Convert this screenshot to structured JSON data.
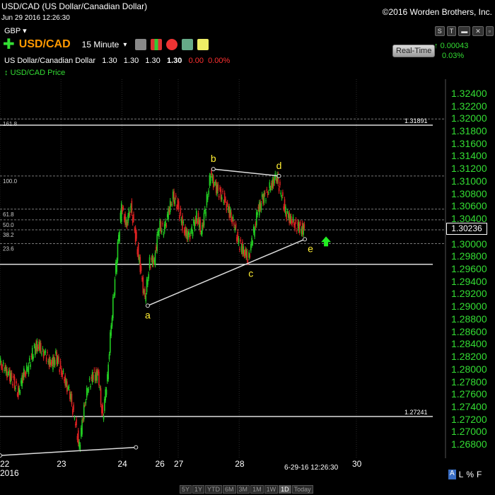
{
  "header": {
    "title": "USD/CAD (US Dollar/Canadian Dollar)",
    "date": "Jun 29 2016 12:26:30",
    "copyright": "©2016 Worden Brothers, Inc.",
    "currency": "GBP",
    "symbol": "USD/CAD",
    "interval": "15 Minute",
    "realtime_label": "Real-Time",
    "change": "0.00043",
    "change_pct": "0.03%",
    "window_buttons": [
      "S",
      "T",
      "▬",
      "✕",
      "▫"
    ]
  },
  "quote": {
    "name": "US Dollar/Canadian Dollar",
    "open": "1.30",
    "high": "1.30",
    "low": "1.30",
    "last": "1.30",
    "chg": "0.00",
    "chg_pct": "0.00%"
  },
  "legend": {
    "label": "USD/CAD Price"
  },
  "price_tag": "1.30236",
  "stamp": "6-29-16 12:26:30",
  "year_label": "2016",
  "period_buttons": [
    "5Y",
    "1Y",
    "YTD",
    "6M",
    "3M",
    "1M",
    "1W",
    "1D",
    "Today"
  ],
  "period_active": "1D",
  "corner_buttons": [
    "A",
    "L",
    "%",
    "F"
  ],
  "chart_data": {
    "type": "line",
    "style": "candlestick",
    "ylim": [
      1.266,
      1.326
    ],
    "y_ticks": [
      "1.32400",
      "1.32200",
      "1.32000",
      "1.31800",
      "1.31600",
      "1.31400",
      "1.31200",
      "1.31000",
      "1.30800",
      "1.30600",
      "1.30400",
      "1.30200",
      "1.30000",
      "1.29800",
      "1.29600",
      "1.29400",
      "1.29200",
      "1.29000",
      "1.28800",
      "1.28600",
      "1.28400",
      "1.28200",
      "1.28000",
      "1.27800",
      "1.27600",
      "1.27400",
      "1.27200",
      "1.27000",
      "1.26800"
    ],
    "x_ticks": [
      "22",
      "23",
      "24",
      "26",
      "27",
      "28",
      "30"
    ],
    "x_tick_positions": [
      0,
      13,
      26,
      34,
      38,
      51,
      76
    ],
    "x_range": [
      0,
      95
    ],
    "levels": [
      {
        "label": "1.31891",
        "value": 1.31891,
        "solid": true
      },
      {
        "label": "1.27241",
        "value": 1.27241,
        "solid": true
      },
      {
        "label": "",
        "value": 1.2967,
        "solid": true
      }
    ],
    "fib_levels": [
      {
        "label": "161.8",
        "value": 1.3199
      },
      {
        "label": "100.0",
        "value": 1.3108
      },
      {
        "label": "61.8",
        "value": 1.3055
      },
      {
        "label": "50.0",
        "value": 1.3038
      },
      {
        "label": "38.2",
        "value": 1.3022
      },
      {
        "label": "23.6",
        "value": 1.3
      }
    ],
    "waves": [
      {
        "label": "a",
        "x": 31.5,
        "y": 1.2901
      },
      {
        "label": "b",
        "x": 45.5,
        "y": 1.3119
      },
      {
        "label": "c",
        "x": 53.5,
        "y": 1.2972
      },
      {
        "label": "d",
        "x": 59.5,
        "y": 1.3108
      },
      {
        "label": "e",
        "x": 65.0,
        "y": 1.3007
      }
    ],
    "trendlines": [
      {
        "from": [
          31.5,
          1.2901
        ],
        "to": [
          65.0,
          1.3007
        ]
      },
      {
        "from": [
          45.5,
          1.3119
        ],
        "to": [
          59.5,
          1.3108
        ]
      },
      {
        "from": [
          0,
          1.2662
        ],
        "to": [
          29,
          1.2675
        ]
      }
    ],
    "path": [
      [
        0,
        1.281
      ],
      [
        1,
        1.28
      ],
      [
        2,
        1.279
      ],
      [
        3,
        1.278
      ],
      [
        4,
        1.276
      ],
      [
        5,
        1.279
      ],
      [
        6,
        1.28
      ],
      [
        7,
        1.2825
      ],
      [
        8,
        1.284
      ],
      [
        9,
        1.283
      ],
      [
        10,
        1.282
      ],
      [
        11,
        1.2805
      ],
      [
        12,
        1.282
      ],
      [
        13,
        1.28
      ],
      [
        14,
        1.278
      ],
      [
        15,
        1.276
      ],
      [
        16,
        1.272
      ],
      [
        17,
        1.2675
      ],
      [
        18,
        1.274
      ],
      [
        19,
        1.2775
      ],
      [
        20,
        1.279
      ],
      [
        21,
        1.279
      ],
      [
        22,
        1.272
      ],
      [
        23,
        1.279
      ],
      [
        24,
        1.289
      ],
      [
        25,
        1.298
      ],
      [
        26,
        1.306
      ],
      [
        27,
        1.303
      ],
      [
        28,
        1.306
      ],
      [
        29,
        1.301
      ],
      [
        30,
        1.296
      ],
      [
        31,
        1.291
      ],
      [
        32,
        1.297
      ],
      [
        33,
        1.2975
      ],
      [
        34,
        1.303
      ],
      [
        35,
        1.302
      ],
      [
        36,
        1.305
      ],
      [
        37,
        1.3075
      ],
      [
        38,
        1.306
      ],
      [
        39,
        1.303
      ],
      [
        40,
        1.301
      ],
      [
        41,
        1.302
      ],
      [
        42,
        1.3045
      ],
      [
        43,
        1.302
      ],
      [
        44,
        1.306
      ],
      [
        45,
        1.311
      ],
      [
        46,
        1.309
      ],
      [
        47,
        1.308
      ],
      [
        48,
        1.307
      ],
      [
        49,
        1.305
      ],
      [
        50,
        1.303
      ],
      [
        51,
        1.3
      ],
      [
        52,
        1.299
      ],
      [
        53,
        1.2975
      ],
      [
        54,
        1.301
      ],
      [
        55,
        1.305
      ],
      [
        56,
        1.307
      ],
      [
        57,
        1.308
      ],
      [
        58,
        1.3095
      ],
      [
        59,
        1.3108
      ],
      [
        60,
        1.308
      ],
      [
        61,
        1.305
      ],
      [
        62,
        1.304
      ],
      [
        63,
        1.303
      ],
      [
        64,
        1.3025
      ],
      [
        65,
        1.3022
      ]
    ]
  }
}
